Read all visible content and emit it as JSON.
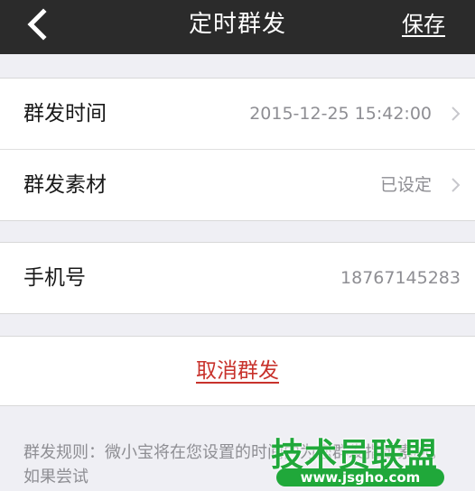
{
  "navbar": {
    "back_icon": "chevron-left-icon",
    "title": "定时群发",
    "save_label": "保存"
  },
  "schedule_group": {
    "send_time": {
      "label": "群发时间",
      "value": "2015-12-25 15:42:00",
      "icon": "chevron-right-icon"
    },
    "material": {
      "label": "群发素材",
      "value": "已设定",
      "icon": "chevron-right-icon"
    }
  },
  "phone_group": {
    "label": "手机号",
    "value": "18767145283"
  },
  "cancel_label": "取消群发",
  "rules_text": "群发规则：微小宝将在您设置的时间内为您群发指定素材，如果尝试",
  "watermark": {
    "title": "技术员联盟",
    "url": "www.jsgho.com"
  },
  "colors": {
    "navbar_bg": "#2b2b2b",
    "page_bg": "#efeff4",
    "danger": "#c8322c",
    "watermark_green": "#20a83a"
  }
}
